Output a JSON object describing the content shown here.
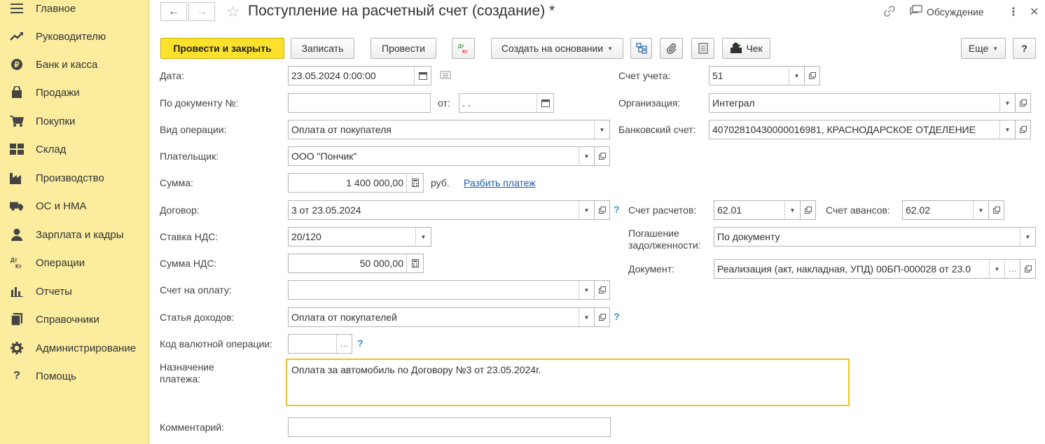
{
  "sidebar": {
    "items": [
      {
        "label": "Главное",
        "icon": "menu-icon"
      },
      {
        "label": "Руководителю",
        "icon": "trend-icon"
      },
      {
        "label": "Банк и касса",
        "icon": "coin-icon"
      },
      {
        "label": "Продажи",
        "icon": "bag-icon"
      },
      {
        "label": "Покупки",
        "icon": "cart-icon"
      },
      {
        "label": "Склад",
        "icon": "warehouse-icon"
      },
      {
        "label": "Производство",
        "icon": "factory-icon"
      },
      {
        "label": "ОС и НМА",
        "icon": "truck-icon"
      },
      {
        "label": "Зарплата и кадры",
        "icon": "person-icon"
      },
      {
        "label": "Операции",
        "icon": "dt-kt-icon"
      },
      {
        "label": "Отчеты",
        "icon": "bar-chart-icon"
      },
      {
        "label": "Справочники",
        "icon": "books-icon"
      },
      {
        "label": "Администрирование",
        "icon": "gear-icon"
      },
      {
        "label": "Помощь",
        "icon": "question-icon"
      }
    ],
    "dtkt_top": "Дт",
    "dtkt_bottom": "Кт"
  },
  "header": {
    "title": "Поступление на расчетный счет (создание) *",
    "discussion": "Обсуждение"
  },
  "toolbar": {
    "post_close": "Провести и закрыть",
    "save": "Записать",
    "post": "Провести",
    "dtkt_top": "Дт",
    "dtkt_bottom": "Кт",
    "create_based": "Создать на основании",
    "receipt": "Чек",
    "more": "Еще",
    "help": "?"
  },
  "form": {
    "date": {
      "label": "Дата:",
      "value": "23.05.2024  0:00:00"
    },
    "doc_num": {
      "label": "По документу №:",
      "value": "",
      "from_label": "от:",
      "from_value": " .  ."
    },
    "operation": {
      "label": "Вид операции:",
      "value": "Оплата от покупателя"
    },
    "payer": {
      "label": "Плательщик:",
      "value": "ООО \"Пончик\""
    },
    "sum": {
      "label": "Сумма:",
      "value": "1 400 000,00",
      "currency": "руб.",
      "split_link": "Разбить платеж"
    },
    "contract": {
      "label": "Договор:",
      "value": "3 от 23.05.2024",
      "help": "?"
    },
    "vat_rate": {
      "label": "Ставка НДС:",
      "value": "20/120"
    },
    "vat_sum": {
      "label": "Сумма НДС:",
      "value": "50 000,00"
    },
    "invoice": {
      "label": "Счет на оплату:",
      "value": ""
    },
    "income_item": {
      "label": "Статья доходов:",
      "value": "Оплата от покупателей",
      "help": "?"
    },
    "currency_code": {
      "label": "Код валютной операции:",
      "value": "",
      "help": "?"
    },
    "purpose": {
      "label_line1": "Назначение",
      "label_line2": "платежа:",
      "value": "Оплата за автомобиль по Договору №3 от 23.05.2024г."
    },
    "comment": {
      "label": "Комментарий:",
      "value": ""
    },
    "account": {
      "label": "Счет учета:",
      "value": "51"
    },
    "organization": {
      "label": "Организация:",
      "value": "Интеграл"
    },
    "bank_account": {
      "label": "Банковский счет:",
      "value": "40702810430000016981, КРАСНОДАРСКОЕ ОТДЕЛЕНИЕ"
    },
    "settlement_account": {
      "label": "Счет расчетов:",
      "value": "62.01"
    },
    "advance_account": {
      "label": "Счет авансов:",
      "value": "62.02"
    },
    "debt_repayment": {
      "label_line1": "Погашение",
      "label_line2": "задолженности:",
      "value": "По документу"
    },
    "document": {
      "label": "Документ:",
      "value": "Реализация (акт, накладная, УПД) 00БП-000028 от 23.0"
    }
  }
}
